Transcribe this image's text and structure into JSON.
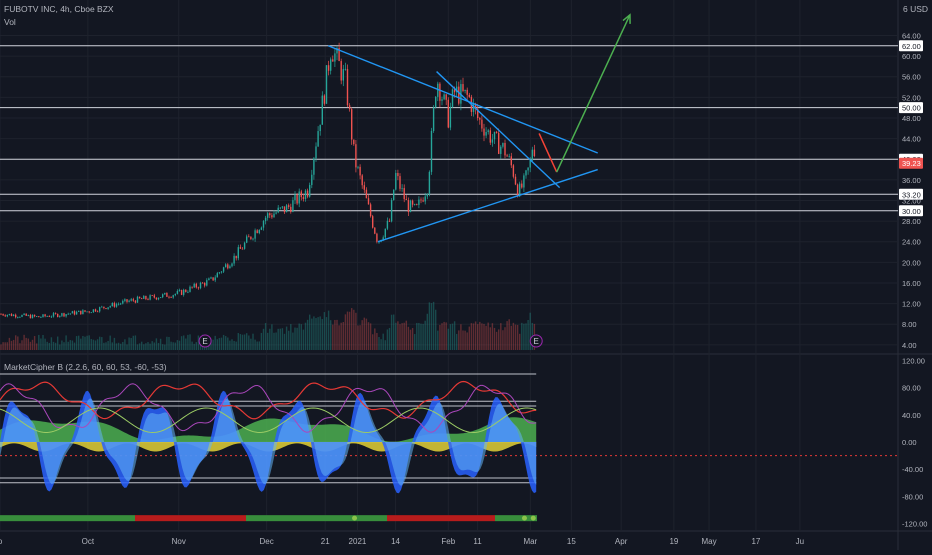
{
  "header": {
    "symbol_line": "FUBOTV INC, 4h, Cboe BZX",
    "vol_label": "Vol",
    "indicator_line": "MarketCipher B (2.2.6, 60, 60, 53, -60, -53)",
    "currency": "6 USD"
  },
  "colors": {
    "background": "#131722",
    "up_candle": "#26a69a",
    "down_candle": "#ef5350",
    "trendline": "#2196f3",
    "arrow_up": "#4caf50",
    "arrow_down": "#f44336",
    "price_badge": "#ef5350",
    "mf_green": "#4caf50",
    "wave_blue": "#2962ff",
    "wave_light": "#64b5f6",
    "rsi_red": "#e53935",
    "stoch_purple": "#ab47bc",
    "momentum_yellow": "#ffeb3b"
  },
  "chart_data": [
    {
      "type": "candlestick",
      "title": "FUBOTV INC, 4h, Cboe BZX",
      "x_ticks": [
        "p",
        "Oct",
        "Nov",
        "Dec",
        "21",
        "2021",
        "14",
        "Feb",
        "11",
        "Mar",
        "15",
        "Apr",
        "19",
        "May",
        "17",
        "Ju"
      ],
      "y_ticks": [
        4.0,
        8.0,
        12.0,
        16.0,
        20.0,
        24.0,
        28.0,
        32.0,
        36.0,
        40.0,
        44.0,
        48.0,
        52.0,
        56.0,
        60.0,
        64.0
      ],
      "ylim": [
        3,
        67
      ],
      "price_series": [
        [
          "2020-09-01",
          10.0
        ],
        [
          "2020-09-14",
          9.4
        ],
        [
          "2020-10-01",
          10.5
        ],
        [
          "2020-10-15",
          12.5
        ],
        [
          "2020-11-01",
          14.0
        ],
        [
          "2020-11-12",
          16.5
        ],
        [
          "2020-11-20",
          21.0
        ],
        [
          "2020-12-01",
          29.0
        ],
        [
          "2020-12-08",
          30.5
        ],
        [
          "2020-12-15",
          34.0
        ],
        [
          "2020-12-21",
          54.0
        ],
        [
          "2020-12-23",
          62.0
        ],
        [
          "2020-12-28",
          55.0
        ],
        [
          "2020-12-31",
          40.0
        ],
        [
          "2021-01-05",
          30.0
        ],
        [
          "2021-01-08",
          24.0
        ],
        [
          "2021-01-12",
          28.0
        ],
        [
          "2021-01-14",
          37.0
        ],
        [
          "2021-01-18",
          31.0
        ],
        [
          "2021-01-21",
          30.0
        ],
        [
          "2021-01-25",
          35.0
        ],
        [
          "2021-01-28",
          56.0
        ],
        [
          "2021-02-01",
          48.0
        ],
        [
          "2021-02-03",
          53.0
        ],
        [
          "2021-02-08",
          52.0
        ],
        [
          "2021-02-11",
          48.0
        ],
        [
          "2021-02-16",
          44.0
        ],
        [
          "2021-02-20",
          42.0
        ],
        [
          "2021-02-23",
          38.0
        ],
        [
          "2021-02-25",
          33.5
        ],
        [
          "2021-02-27",
          35.5
        ],
        [
          "2021-03-01",
          39.2
        ],
        [
          "2021-03-02",
          44.0
        ],
        [
          "2021-03-03",
          39.2
        ]
      ],
      "horizontal_levels": [
        62.0,
        50.0,
        40.0,
        33.2,
        30.0
      ],
      "price_labels": [
        "64.00",
        "62.00",
        "60.00",
        "56.00",
        "52.00",
        "50.00",
        "48.00",
        "44.00",
        "40.00",
        "39.23",
        "36.00",
        "33.20",
        "32.00",
        "30.00",
        "28.00",
        "24.00",
        "20.00",
        "16.00",
        "12.00",
        "8.00",
        "4.00"
      ],
      "last_price": "39.23",
      "trendlines": [
        {
          "from": [
            "2020-12-22",
            62.0
          ],
          "to": [
            "2021-03-24",
            41.2
          ]
        },
        {
          "from": [
            "2021-01-28",
            57.0
          ],
          "to": [
            "2021-03-11",
            34.5
          ]
        },
        {
          "from": [
            "2021-01-08",
            24.0
          ],
          "to": [
            "2021-03-24",
            38.0
          ]
        }
      ],
      "projection_arrows": [
        {
          "color": "red",
          "points": [
            [
              "2021-03-04",
              45.0
            ],
            [
              "2021-03-10",
              37.5
            ]
          ]
        },
        {
          "color": "green",
          "points": [
            [
              "2021-03-10",
              37.5
            ],
            [
              "2021-04-04",
              68.0
            ]
          ]
        }
      ],
      "earnings_markers": [
        "E",
        "E"
      ]
    },
    {
      "type": "oscillator",
      "title": "MarketCipher B (2.2.6, 60, 60, 53, -60, -53)",
      "y_ticks": [
        120.0,
        80.0,
        40.0,
        0.0,
        -40.0,
        -80.0,
        -120.0
      ],
      "tick_labels": [
        "120.00",
        "80.00",
        "40.00",
        "0.00",
        "-40.00",
        "-80.00",
        "-120.00"
      ],
      "ylim": [
        -125,
        125
      ],
      "reference_levels": [
        100,
        60,
        53,
        0,
        -53,
        -60
      ],
      "dotted_level": -20
    }
  ]
}
